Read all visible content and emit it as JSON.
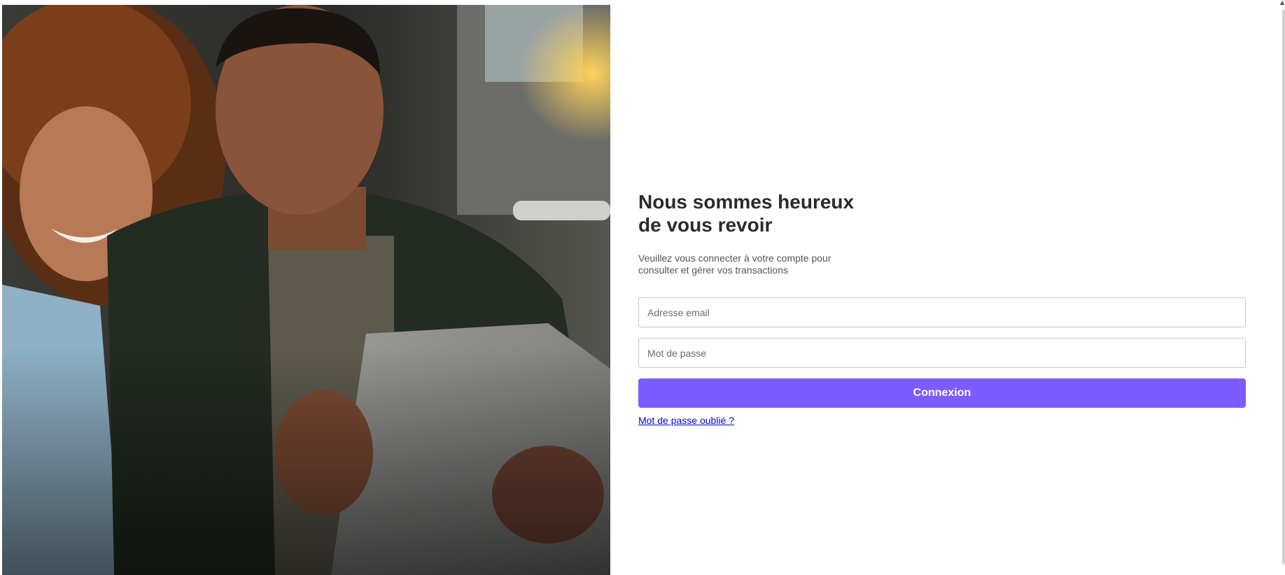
{
  "hero": {
    "image_name": "people-looking-at-tablet-photo"
  },
  "login": {
    "title_line1": "Nous sommes heureux",
    "title_line2": "de vous revoir",
    "subtitle": "Veuillez vous connecter à votre compte pour consulter et gérer vos transactions",
    "email_placeholder": "Adresse email",
    "email_value": "",
    "password_placeholder": "Mot de passe",
    "password_value": "",
    "submit_label": "Connexion",
    "forgot_label": "Mot de passe oublié ?"
  },
  "colors": {
    "accent": "#7b5cff",
    "link": "#0000ee",
    "title": "#2b2b2b"
  },
  "icons": {
    "scroll_up": "chevron-up-icon"
  }
}
